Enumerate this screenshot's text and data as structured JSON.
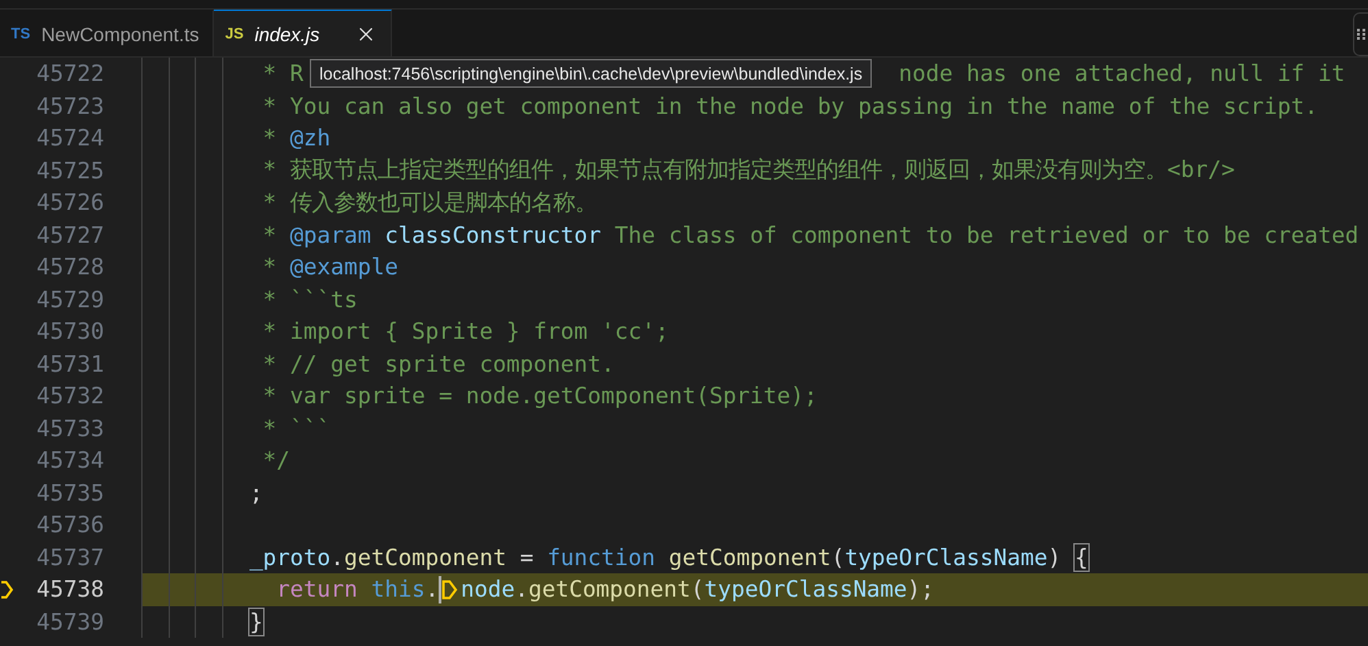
{
  "tabs": [
    {
      "label": "NewComponent.ts",
      "badge": "TS",
      "kind": "ts",
      "selected": false,
      "preview": false
    },
    {
      "label": "index.js",
      "badge": "JS",
      "kind": "js",
      "selected": true,
      "preview": true
    }
  ],
  "tooltip": "localhost:7456\\scripting\\engine\\bin\\.cache\\dev\\preview\\bundled\\index.js",
  "lines": [
    {
      "number": "45722",
      "current": false,
      "tokens": [
        {
          "t": " * R",
          "kind": "comment"
        },
        {
          "kind": "gap"
        },
        {
          "t": "node has one attached, null if it",
          "kind": "comment"
        }
      ]
    },
    {
      "number": "45723",
      "current": false,
      "tokens": [
        {
          "t": " * You can also get component in the node by passing in the name of the script.",
          "kind": "comment"
        }
      ]
    },
    {
      "number": "45724",
      "current": false,
      "tokens": [
        {
          "t": " * ",
          "kind": "comment"
        },
        {
          "t": "@zh",
          "kind": "tag"
        }
      ]
    },
    {
      "number": "45725",
      "current": false,
      "tokens": [
        {
          "t": " * 获取节点上指定类型的组件，如果节点有附加指定类型的组件，则返回，如果没有则为空。<br/>",
          "kind": "comment"
        }
      ]
    },
    {
      "number": "45726",
      "current": false,
      "tokens": [
        {
          "t": " * 传入参数也可以是脚本的名称。",
          "kind": "comment"
        }
      ]
    },
    {
      "number": "45727",
      "current": false,
      "tokens": [
        {
          "t": " * ",
          "kind": "comment"
        },
        {
          "t": "@param",
          "kind": "tag"
        },
        {
          "t": " classConstructor",
          "kind": "param"
        },
        {
          "t": " The class of component to be retrieved or to be created",
          "kind": "comment"
        }
      ]
    },
    {
      "number": "45728",
      "current": false,
      "tokens": [
        {
          "t": " * ",
          "kind": "comment"
        },
        {
          "t": "@example",
          "kind": "tag"
        }
      ]
    },
    {
      "number": "45729",
      "current": false,
      "tokens": [
        {
          "t": " * ```ts",
          "kind": "comment"
        }
      ]
    },
    {
      "number": "45730",
      "current": false,
      "tokens": [
        {
          "t": " * import { Sprite } from 'cc';",
          "kind": "comment"
        }
      ]
    },
    {
      "number": "45731",
      "current": false,
      "tokens": [
        {
          "t": " * // get sprite component.",
          "kind": "comment"
        }
      ]
    },
    {
      "number": "45732",
      "current": false,
      "tokens": [
        {
          "t": " * var sprite = node.getComponent(Sprite);",
          "kind": "comment"
        }
      ]
    },
    {
      "number": "45733",
      "current": false,
      "tokens": [
        {
          "t": " * ```",
          "kind": "comment"
        }
      ]
    },
    {
      "number": "45734",
      "current": false,
      "tokens": [
        {
          "t": " */",
          "kind": "comment"
        }
      ]
    },
    {
      "number": "45735",
      "current": false,
      "tokens": [
        {
          "t": ";",
          "kind": "plain"
        }
      ]
    },
    {
      "number": "45736",
      "current": false
    },
    {
      "number": "45737",
      "current": false,
      "tokens": [
        {
          "t": "_proto",
          "kind": "variable"
        },
        {
          "t": ".",
          "kind": "plain"
        },
        {
          "t": "getComponent",
          "kind": "function"
        },
        {
          "t": " = ",
          "kind": "plain"
        },
        {
          "t": "function",
          "kind": "keyword"
        },
        {
          "t": " getComponent",
          "kind": "function"
        },
        {
          "t": "(",
          "kind": "plain"
        },
        {
          "t": "typeOrClassName",
          "kind": "variable"
        },
        {
          "t": ") ",
          "kind": "plain"
        },
        {
          "t": "{",
          "kind": "bracket"
        }
      ]
    },
    {
      "number": "45738",
      "current": true,
      "tokens": [
        {
          "t": "  return",
          "kind": "control"
        },
        {
          "t": " this",
          "kind": "keyword"
        },
        {
          "t": ".",
          "kind": "plain"
        },
        {
          "kind": "cursor"
        },
        {
          "kind": "marker"
        },
        {
          "t": "node",
          "kind": "variable"
        },
        {
          "t": ".",
          "kind": "plain"
        },
        {
          "t": "getComponent",
          "kind": "function"
        },
        {
          "t": "(",
          "kind": "plain"
        },
        {
          "t": "typeOrClassName",
          "kind": "variable"
        },
        {
          "t": ");",
          "kind": "plain"
        }
      ]
    },
    {
      "number": "45739",
      "current": false,
      "tokens": [
        {
          "t": "}",
          "kind": "bracket"
        }
      ]
    }
  ]
}
